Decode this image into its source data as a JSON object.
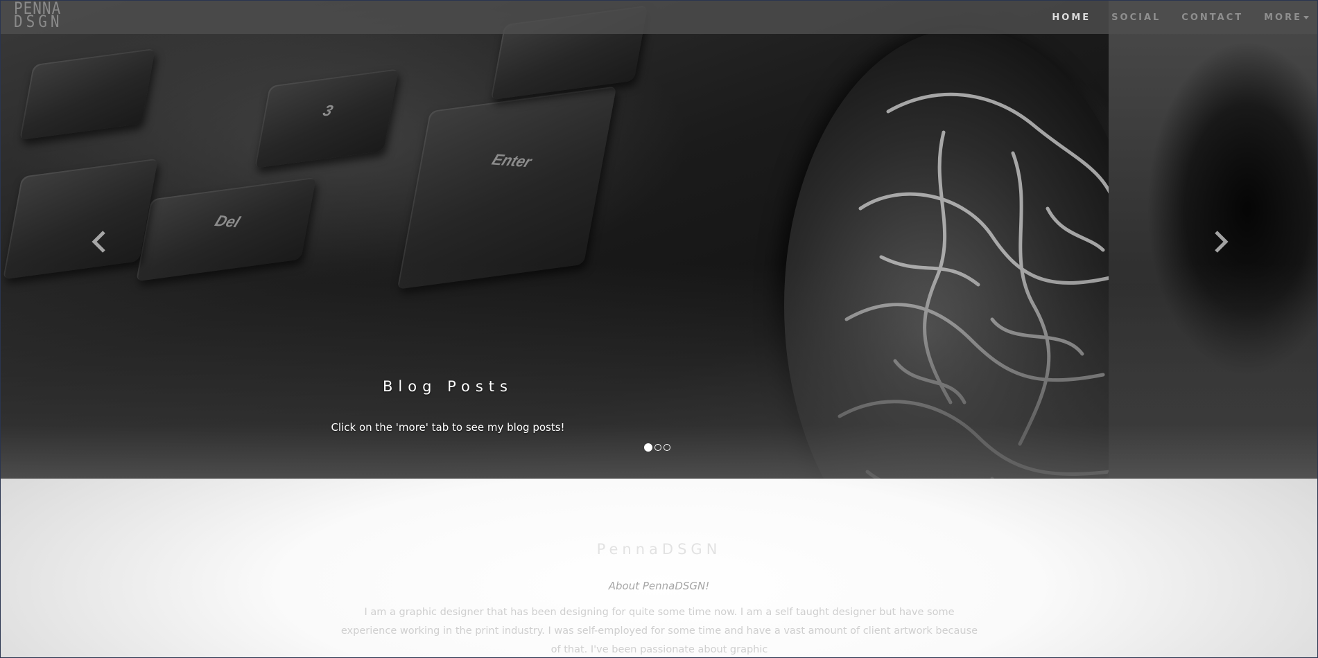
{
  "navbar": {
    "brand": {
      "line1": "PENNA",
      "line2": "DSGN"
    },
    "links": [
      {
        "label": "HOME",
        "active": true
      },
      {
        "label": "SOCIAL",
        "active": false
      },
      {
        "label": "CONTACT",
        "active": false
      },
      {
        "label": "MORE",
        "active": false,
        "dropdown": true
      }
    ]
  },
  "carousel": {
    "caption_title": "Blog Posts",
    "caption_text": "Click on the 'more' tab to see my blog posts!",
    "slide_count": 3,
    "active_slide": 1,
    "keycaps": [
      "Enter",
      "3",
      "Del"
    ],
    "prev_icon": "chevron-left-icon",
    "next_icon": "chevron-right-icon"
  },
  "about": {
    "title": "PennaDSGN",
    "subtitle": "About PennaDSGN!",
    "text": "I am a graphic designer that has been designing for quite some time now. I am a self taught designer but have some experience working in the print industry. I was self-employed for some time and have a vast amount of client artwork because of that. I've been passionate about graphic"
  },
  "colors": {
    "navbar_bg": "#4e4e4e",
    "nav_active": "#dddddd",
    "nav_inactive": "#8f8f8f",
    "about_title": "#e2e2e2"
  }
}
